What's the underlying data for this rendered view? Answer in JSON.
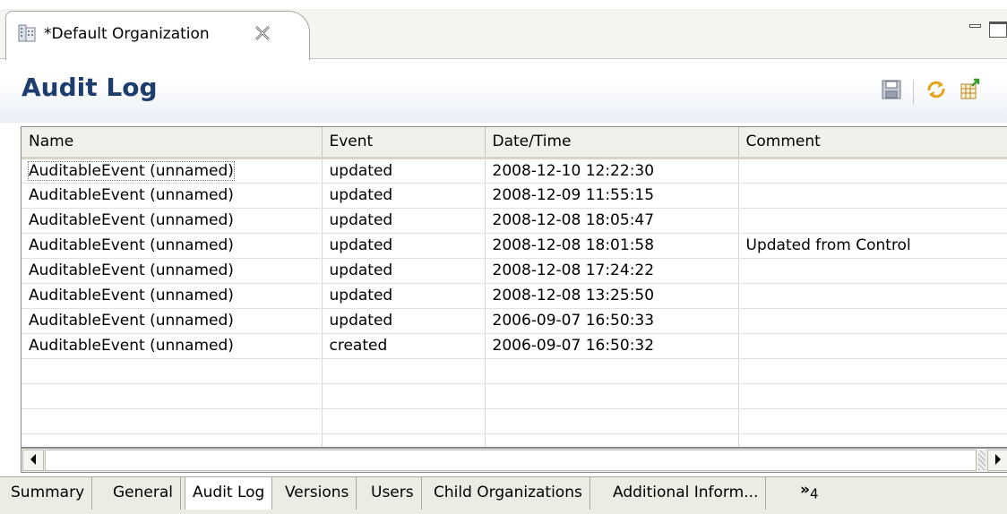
{
  "editor_tab": {
    "title": "*Default Organization"
  },
  "header": {
    "title": "Audit Log"
  },
  "toolbar": {
    "icons": [
      "save-icon",
      "refresh-icon",
      "export-icon"
    ]
  },
  "table": {
    "columns": [
      "Name",
      "Event",
      "Date/Time",
      "Comment"
    ],
    "rows": [
      [
        "AuditableEvent (unnamed)",
        "updated",
        "2008-12-10 12:22:30",
        ""
      ],
      [
        "AuditableEvent (unnamed)",
        "updated",
        "2008-12-09 11:55:15",
        ""
      ],
      [
        "AuditableEvent (unnamed)",
        "updated",
        "2008-12-08 18:05:47",
        ""
      ],
      [
        "AuditableEvent (unnamed)",
        "updated",
        "2008-12-08 18:01:58",
        "Updated from Control"
      ],
      [
        "AuditableEvent (unnamed)",
        "updated",
        "2008-12-08 17:24:22",
        ""
      ],
      [
        "AuditableEvent (unnamed)",
        "updated",
        "2008-12-08 13:25:50",
        ""
      ],
      [
        "AuditableEvent (unnamed)",
        "updated",
        "2006-09-07 16:50:33",
        ""
      ],
      [
        "AuditableEvent (unnamed)",
        "created",
        "2006-09-07 16:50:32",
        ""
      ]
    ],
    "empty_rows": 4
  },
  "page_tabs": {
    "items": [
      "Summary",
      "General",
      "Audit Log",
      "Versions",
      "Users",
      "Child Organizations",
      "Additional Inform..."
    ],
    "active": "Audit Log",
    "overflow_label": "»",
    "overflow_count": "4"
  }
}
